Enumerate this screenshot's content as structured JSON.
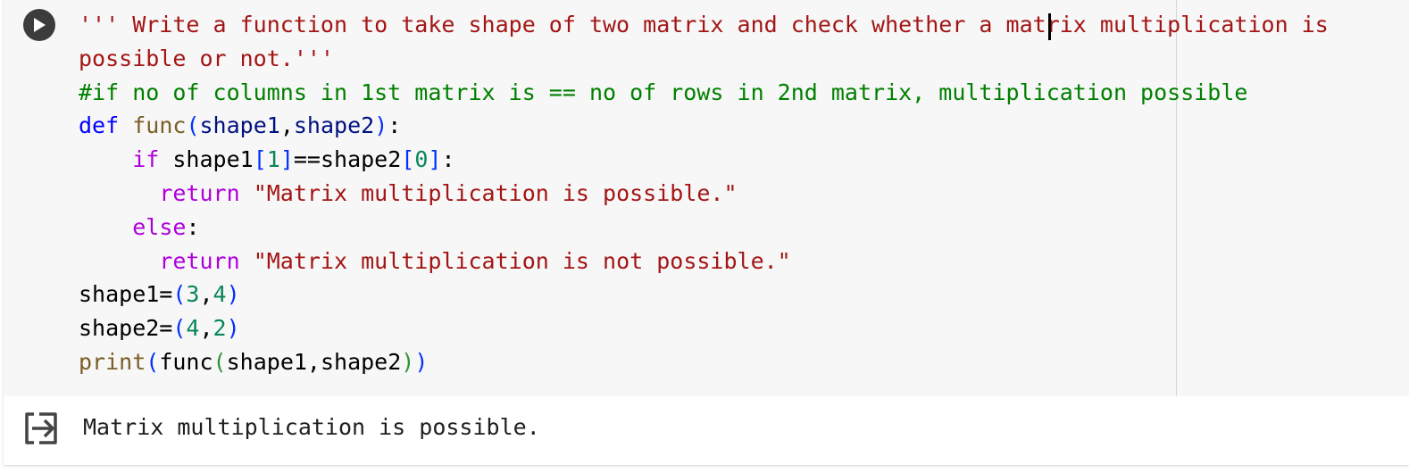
{
  "run_button": {
    "icon": "play-icon"
  },
  "code_lines": [
    "''' Write a function to take shape of two matrix and check whether a matrix multiplication is possible or not.'''",
    "#if no of columns in 1st matrix is == no of rows in 2nd matrix, multiplication possible",
    "def func(shape1,shape2):",
    "    if shape1[1]==shape2[0]:",
    "      return \"Matrix multiplication is possible.\"",
    "    else:",
    "      return \"Matrix multiplication is not possible.\"",
    "shape1=(3,4)",
    "shape2=(4,2)",
    "print(func(shape1,shape2))"
  ],
  "output": {
    "icon": "output-redirect-icon",
    "text": "Matrix multiplication is possible."
  },
  "colors": {
    "string": "#a31515",
    "comment": "#008000",
    "keyword": "#0000ff",
    "function": "#795e26",
    "variable": "#001080",
    "control": "#af00db",
    "number": "#098658",
    "bracket_level1": "#0431fa",
    "bracket_level2": "#319331",
    "editor_background": "#f7f7f7"
  }
}
